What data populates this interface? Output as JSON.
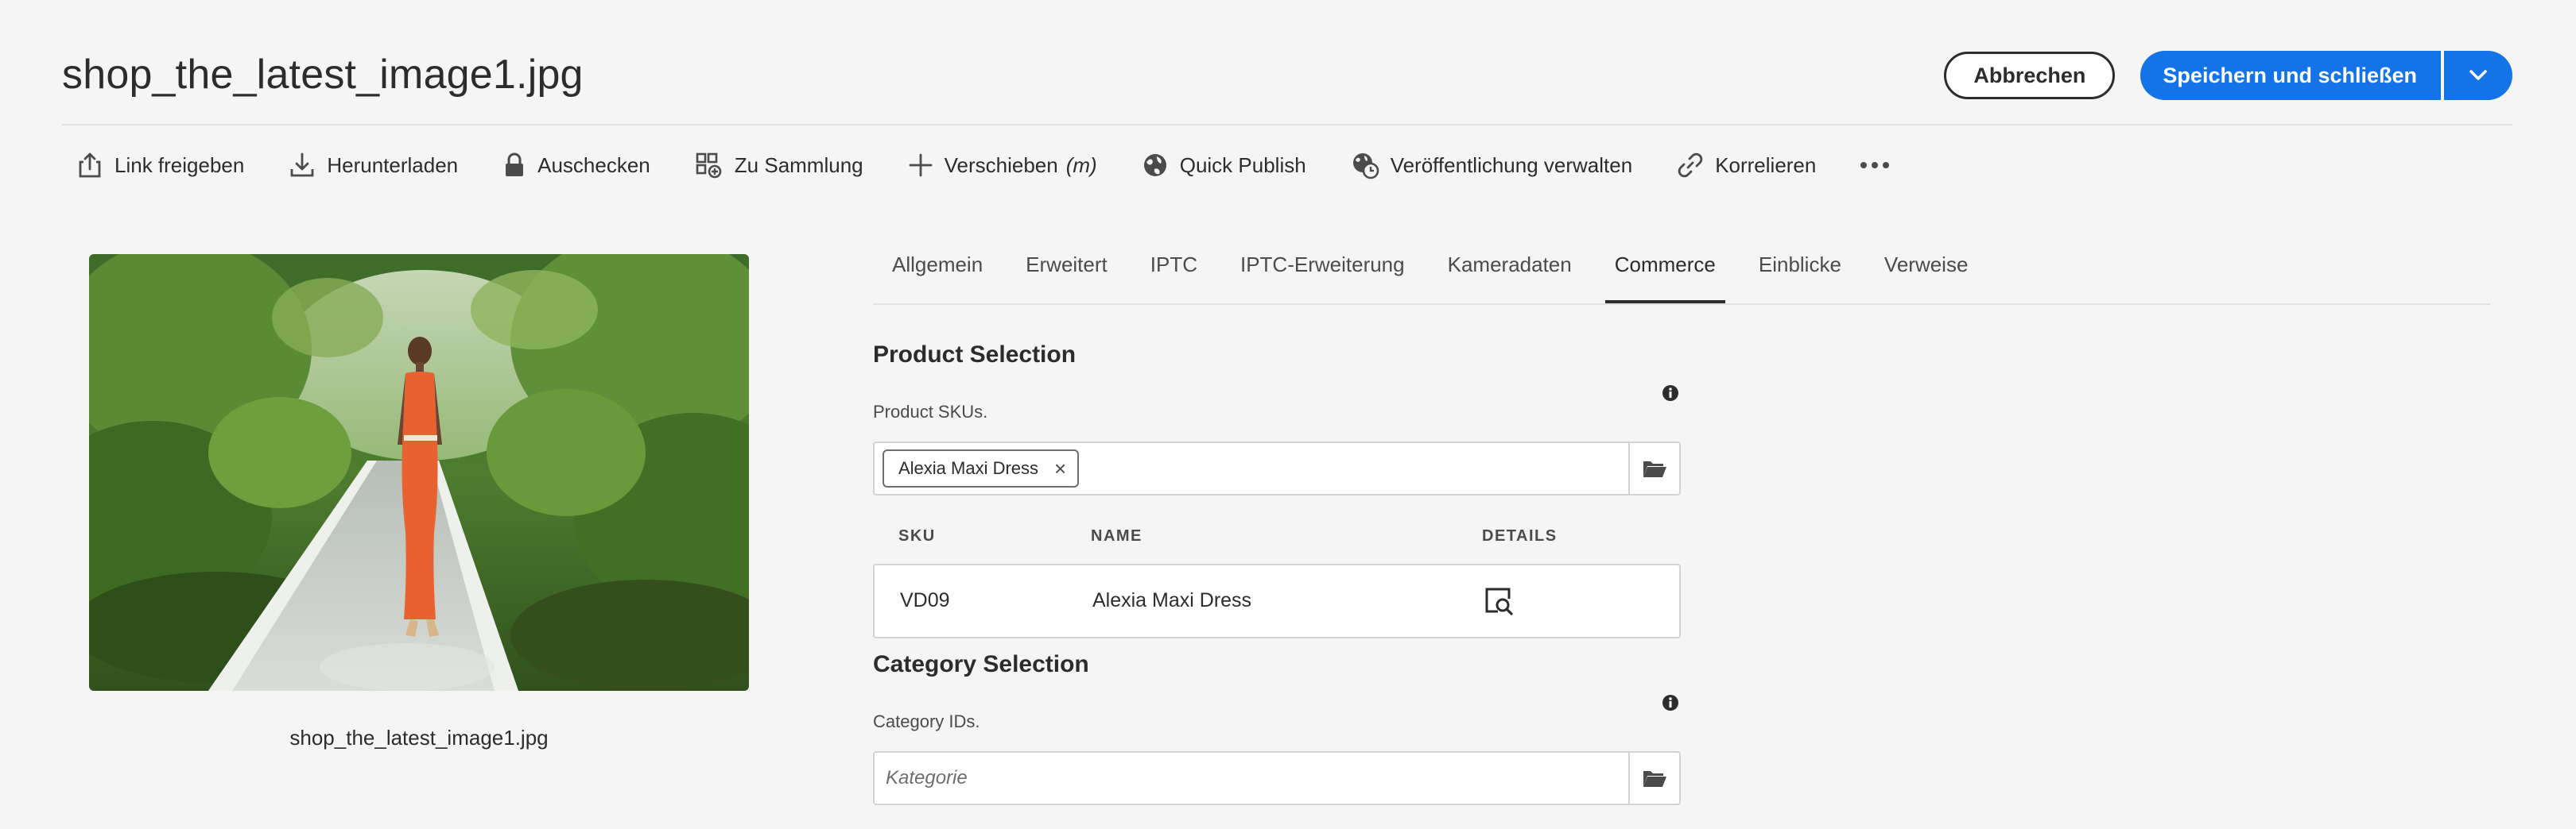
{
  "header": {
    "title": "shop_the_latest_image1.jpg",
    "cancel_label": "Abbrechen",
    "save_label": "Speichern und schließen"
  },
  "toolbar": {
    "share_link": "Link freigeben",
    "download": "Herunterladen",
    "checkout": "Auschecken",
    "to_collection": "Zu Sammlung",
    "move": "Verschieben",
    "move_shortcut": "(m)",
    "quick_publish": "Quick Publish",
    "manage_publication": "Veröffentlichung verwalten",
    "relate": "Korrelieren"
  },
  "preview": {
    "caption": "shop_the_latest_image1.jpg"
  },
  "tabs": [
    "Allgemein",
    "Erweitert",
    "IPTC",
    "IPTC-Erweiterung",
    "Kameradaten",
    "Commerce",
    "Einblicke",
    "Verweise"
  ],
  "active_tab": "Commerce",
  "product_section": {
    "title": "Product Selection",
    "label": "Product SKUs.",
    "tag": "Alexia Maxi Dress",
    "columns": {
      "sku": "SKU",
      "name": "NAME",
      "details": "DETAILS"
    },
    "rows": [
      {
        "sku": "VD09",
        "name": "Alexia Maxi Dress"
      }
    ]
  },
  "category_section": {
    "title": "Category Selection",
    "label": "Category IDs.",
    "placeholder": "Kategorie"
  },
  "colors": {
    "accent": "#1473e6",
    "background": "#f5f5f5",
    "text": "#2c2c2c"
  },
  "icons": [
    "share-icon",
    "download-icon",
    "lock-icon",
    "collection-icon",
    "move-icon",
    "globe-icon",
    "globe-clock-icon",
    "link-icon",
    "more-icon",
    "info-icon",
    "folder-icon",
    "preview-details-icon",
    "chevron-down-icon",
    "close-icon"
  ]
}
